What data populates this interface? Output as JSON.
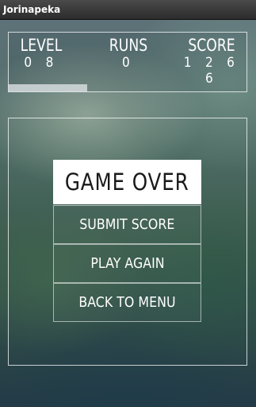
{
  "app": {
    "title": "Jorinapeka"
  },
  "hud": {
    "level_label": "LEVEL",
    "level_value": "0 8",
    "runs_label": "RUNS",
    "runs_value": "0",
    "score_label": "SCORE",
    "score_value": "1 2 6 6",
    "level_progress_fraction": 0.33
  },
  "dialog": {
    "title": "GAME OVER",
    "submit_label": "SUBMIT SCORE",
    "play_again_label": "PLAY AGAIN",
    "back_label": "BACK TO MENU"
  }
}
